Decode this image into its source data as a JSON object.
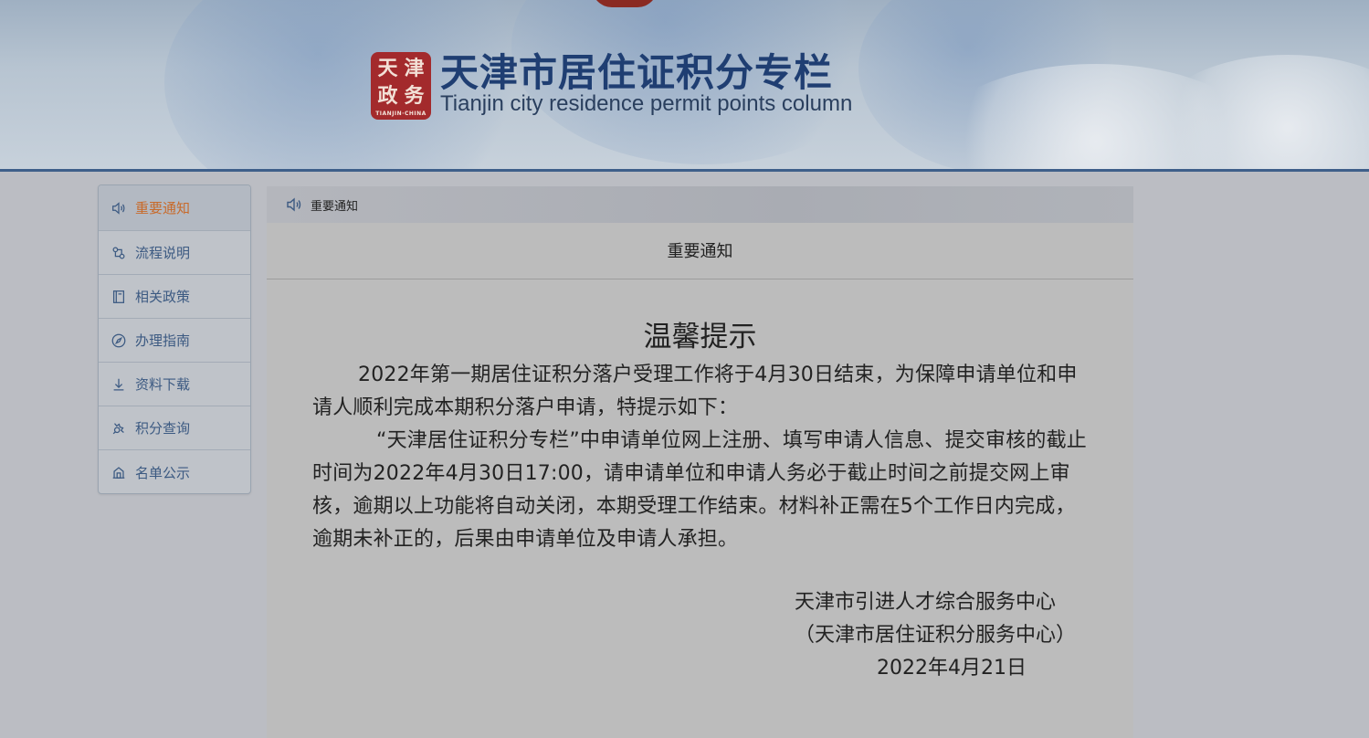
{
  "banner": {
    "title": "天津市居住证积分专栏",
    "subtitle": "Tianjin city residence permit points column",
    "seal": {
      "chars": [
        "天",
        "津",
        "政",
        "务"
      ],
      "foot": "TIANJIN·CHINA",
      "color": "#a32a2c"
    }
  },
  "sidebar": {
    "items": [
      {
        "label": "重要通知",
        "icon": "speaker-icon",
        "active": true
      },
      {
        "label": "流程说明",
        "icon": "flow-icon",
        "active": false
      },
      {
        "label": "相关政策",
        "icon": "book-icon",
        "active": false
      },
      {
        "label": "办理指南",
        "icon": "compass-icon",
        "active": false
      },
      {
        "label": "资料下载",
        "icon": "download-icon",
        "active": false
      },
      {
        "label": "积分查询",
        "icon": "search-points-icon",
        "active": false
      },
      {
        "label": "名单公示",
        "icon": "building-icon",
        "active": false
      }
    ]
  },
  "breadcrumb": {
    "label": "重要通知"
  },
  "content": {
    "header": "重要通知",
    "title": "温馨提示",
    "paragraph1": "2022年第一期居住证积分落户受理工作将于4月30日结束，为保障申请单位和申请人顺利完成本期积分落户申请，特提示如下：",
    "paragraph2": "“天津居住证积分专栏”中申请单位网上注册、填写申请人信息、提交审核的截止时间为2022年4月30日17:00，请申请单位和申请人务必于截止时间之前提交网上审核，逾期以上功能将自动关闭，本期受理工作结束。材料补正需在5个工作日内完成，逾期未补正的，后果由申请单位及申请人承担。",
    "signature_org": "天津市引进人才综合服务中心",
    "signature_sub": "（天津市居住证积分服务中心）",
    "signature_date": "2022年4月21日"
  },
  "colors": {
    "accent_active": "#c86a2a",
    "link": "#3c5a82",
    "banner_border": "#3e5f8a"
  }
}
